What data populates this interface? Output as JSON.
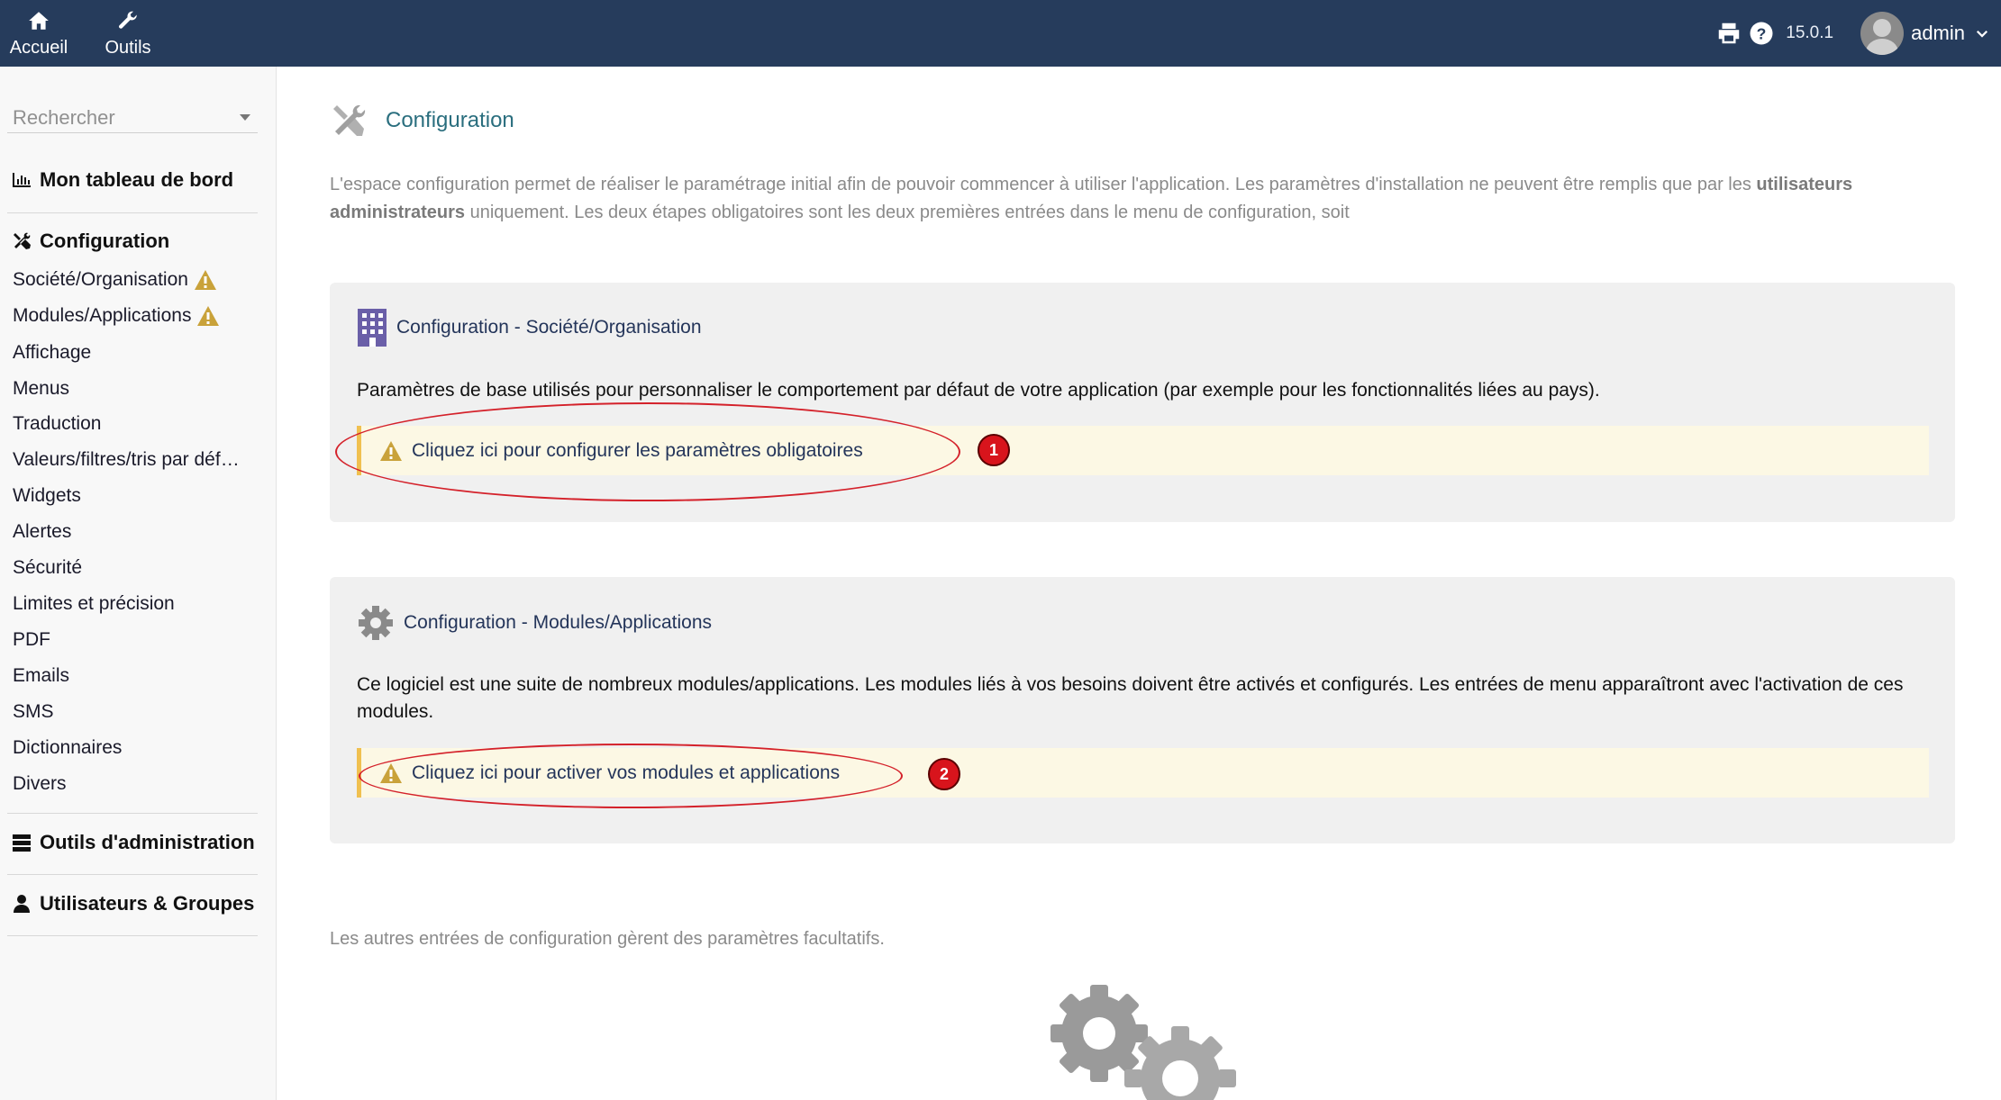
{
  "topbar": {
    "home_label": "Accueil",
    "tools_label": "Outils",
    "version": "15.0.1",
    "user": "admin"
  },
  "sidebar": {
    "search_placeholder": "Rechercher",
    "dashboard_label": "Mon tableau de bord",
    "config_label": "Configuration",
    "items": [
      {
        "label": "Société/Organisation",
        "warning": true
      },
      {
        "label": "Modules/Applications",
        "warning": true
      },
      {
        "label": "Affichage"
      },
      {
        "label": "Menus"
      },
      {
        "label": "Traduction"
      },
      {
        "label": "Valeurs/filtres/tris par déf…"
      },
      {
        "label": "Widgets"
      },
      {
        "label": "Alertes"
      },
      {
        "label": "Sécurité"
      },
      {
        "label": "Limites et précision"
      },
      {
        "label": "PDF"
      },
      {
        "label": "Emails"
      },
      {
        "label": "SMS"
      },
      {
        "label": "Dictionnaires"
      },
      {
        "label": "Divers"
      }
    ],
    "admin_tools_label": "Outils d'administration",
    "users_groups_label": "Utilisateurs & Groupes"
  },
  "main": {
    "title": "Configuration",
    "intro_part1": "L'espace configuration permet de réaliser le paramétrage initial afin de pouvoir commencer à utiliser l'application. Les paramètres d'installation ne peuvent être remplis que par les ",
    "intro_bold": "utilisateurs administrateurs",
    "intro_part2": " uniquement. Les deux étapes obligatoires sont les deux premières entrées dans le menu de configuration, soit",
    "card1": {
      "title": "Configuration - Société/Organisation",
      "description": "Paramètres de base utilisés pour personnaliser le comportement par défaut de votre application (par exemple pour les fonctionnalités liées au pays).",
      "link": "Cliquez ici pour configurer les paramètres obligatoires",
      "badge": "1"
    },
    "card2": {
      "title": "Configuration - Modules/Applications",
      "description": "Ce logiciel est une suite de nombreux modules/applications. Les modules liés à vos besoins doivent être activés et configurés. Les entrées de menu apparaîtront avec l'activation de ces modules.",
      "link": "Cliquez ici pour activer vos modules et applications",
      "badge": "2"
    },
    "footer_note": "Les autres entrées de configuration gèrent des paramètres facultatifs."
  },
  "colors": {
    "topbar": "#263c5c",
    "title": "#2a6e7e",
    "warning_bg": "#fcf8e4",
    "warning_border": "#f0c050",
    "annotation": "#d4212a"
  }
}
